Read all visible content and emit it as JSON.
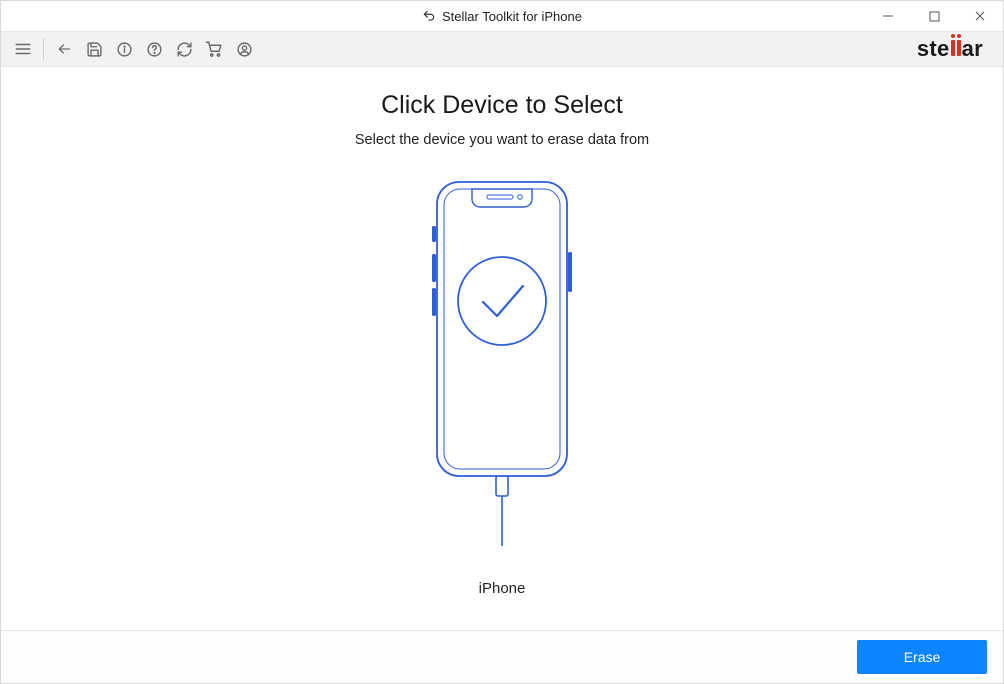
{
  "titlebar": {
    "app_name": "Stellar Toolkit for iPhone"
  },
  "brand": {
    "pre": "ste",
    "post": "ar"
  },
  "main": {
    "heading": "Click Device to Select",
    "subheading": "Select the device you want to erase data from"
  },
  "device": {
    "label": "iPhone"
  },
  "footer": {
    "primary": "Erase"
  },
  "toolbar_icons": {
    "menu": "menu-icon",
    "back": "back-icon",
    "save": "save-icon",
    "info": "info-icon",
    "help": "help-icon",
    "refresh": "refresh-icon",
    "cart": "cart-icon",
    "user": "user-icon"
  }
}
